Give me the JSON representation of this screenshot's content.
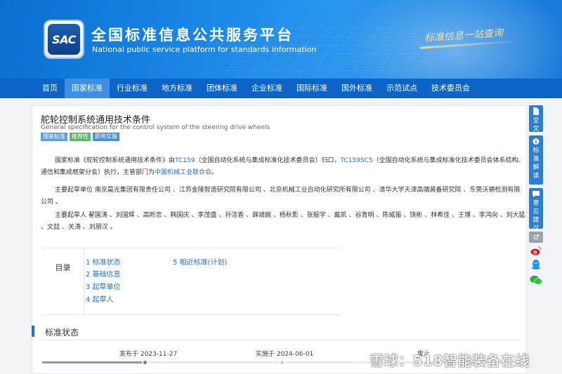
{
  "header": {
    "logo_text": "SAC",
    "title": "全国标准信息公共服务平台",
    "subtitle": "National public service platform  for standards information",
    "slogan": "标准信息一站查询"
  },
  "nav": {
    "items": [
      "首页",
      "国家标准",
      "行业标准",
      "地方标准",
      "团体标准",
      "企业标准",
      "国际标准",
      "国外标准",
      "示范试点",
      "技术委员会"
    ],
    "active_index": 1
  },
  "standard": {
    "title": "舵轮控制系统通用技术条件",
    "title_en": "General specification for the control system of the steering drive wheels",
    "tags": [
      "国家标准",
      "推荐性",
      "即将实施"
    ]
  },
  "intro": {
    "t1": "国家标准《舵轮控制系统通用技术条件》由",
    "link1": "TC159",
    "t2": "（全国自动化系统与集成标准化技术委员会）归口，",
    "link2": "TC159SC5",
    "t3": "（全国自动化系统与集成标准化技术委员会体系结构、通信和集成框架分会）执行，主管部门为",
    "link3": "中国机械工业联合会",
    "t4": "。"
  },
  "drafting_units": {
    "label": "主要起草单位",
    "text": "南京晨光集团有限责任公司 、江苏金陵智造研究院有限公司 、北京机械工业自动化研究所有限公司 、清华大学天津高端装备研究院 、东莞沃德检测有限公司 。"
  },
  "drafters": {
    "label": "主要起草人",
    "text": "翟国涛 、刘国辉 、高昕忠 、韩国庆 、李茂盛 、孙洁香 、薛靖婉 、杨秋影 、张振宇 、戴凯 、谷青明 、陈威振 、饶彬 、林希佳 、王博 、李鸿向 、刘大猛 、文喆 、关涛 、刘朋汉 。"
  },
  "toc": {
    "label": "目录",
    "items": [
      "1  标准状态",
      "2  基础信息",
      "3  起草单位",
      "4  起草人",
      "5  相近标准(计划)"
    ]
  },
  "status_section": {
    "title": "标准状态",
    "publish": "发布于 2023-11-27",
    "implement": "实施于 2024-06-01",
    "third": "废止"
  },
  "sidebar": {
    "fulltext": "全文",
    "interpret": "标准解读",
    "feedback": "意见建议"
  },
  "watermark": {
    "text": "雪球：518智能装备在线"
  },
  "colors": {
    "banner_blue": "#1a86e6",
    "nav_blue": "#0d64c8",
    "nav_active": "#3d8fe6",
    "link_blue": "#2a6fc4",
    "tag_green": "#62b36a"
  }
}
